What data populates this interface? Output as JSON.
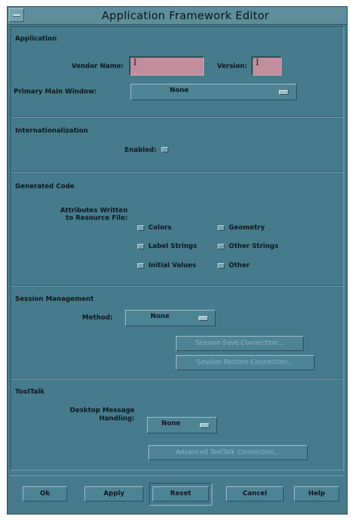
{
  "window": {
    "title": "Application Framework Editor"
  },
  "application": {
    "section_title": "Application",
    "vendor_name_label": "Vendor Name:",
    "vendor_name_value": "I",
    "version_label": "Version:",
    "version_value": "I",
    "primary_main_window_label": "Primary Main Window:",
    "primary_main_window_value": "None"
  },
  "internationalization": {
    "section_title": "Internationalization",
    "enabled_label": "Enabled:"
  },
  "generated_code": {
    "section_title": "Generated Code",
    "attributes_label_line1": "Attributes Written",
    "attributes_label_line2": "to Resource File:",
    "options": [
      {
        "label": "Colors",
        "checked": false
      },
      {
        "label": "Geometry",
        "checked": false
      },
      {
        "label": "Label Strings",
        "checked": false
      },
      {
        "label": "Other Strings",
        "checked": false
      },
      {
        "label": "Initial Values",
        "checked": false
      },
      {
        "label": "Other",
        "checked": false
      }
    ]
  },
  "session_management": {
    "section_title": "Session Management",
    "method_label": "Method:",
    "method_value": "None",
    "save_connection_button": "Session Save Connection...",
    "restore_connection_button": "Session Restore Connection..."
  },
  "tooltalk": {
    "section_title": "ToolTalk",
    "desktop_message_label_line1": "Desktop Message",
    "desktop_message_label_line2": "Handling:",
    "desktop_message_value": "None",
    "advanced_button": "Advanced ToolTalk Connection..."
  },
  "actions": {
    "ok": "Ok",
    "apply": "Apply",
    "reset": "Reset",
    "cancel": "Cancel",
    "help": "Help"
  },
  "colors": {
    "background": "#467b8b",
    "text_field": "#c28e9e",
    "title_bar": "#5e8e9c"
  }
}
